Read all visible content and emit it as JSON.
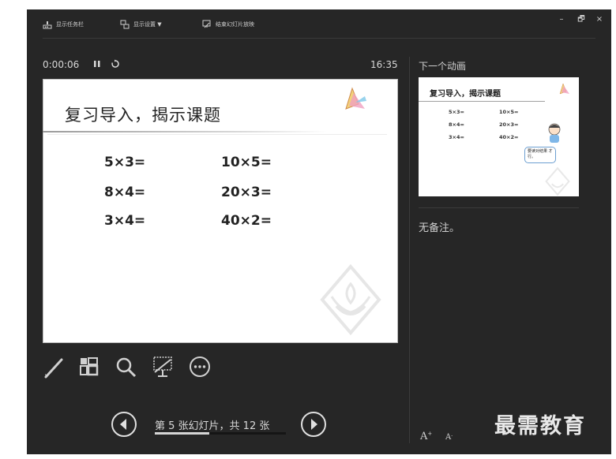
{
  "toolbar": {
    "show_taskbar": "显示任务栏",
    "display_settings": "显示设置 ▼",
    "end_show": "结束幻灯片放映"
  },
  "window_controls": {
    "minimize": "–",
    "restore": "🗗",
    "close": "×"
  },
  "timer": {
    "elapsed": "0:00:06",
    "pause_glyph": "⏸",
    "restart_glyph": "↻"
  },
  "clock": "16:35",
  "slide": {
    "title": "复习导入，揭示课题",
    "equations_left": [
      "5×3=",
      "8×4=",
      "3×4="
    ],
    "equations_right": [
      "10×5=",
      "20×3=",
      "40×2="
    ]
  },
  "tools": [
    {
      "name": "pen-tool-icon"
    },
    {
      "name": "slides-grid-icon"
    },
    {
      "name": "zoom-icon"
    },
    {
      "name": "laser-pointer-icon"
    },
    {
      "name": "more-options-icon"
    }
  ],
  "navigation": {
    "slide_count": "第 5 张幻灯片，共 12 张",
    "progress": 0.4167
  },
  "next_panel": {
    "label": "下一个动画",
    "thumb_title": "复习导入，揭示课题",
    "thumb_equations_left": [
      "5×3=",
      "8×4=",
      "3×4="
    ],
    "thumb_equations_right": [
      "10×5=",
      "20×3=",
      "40×2="
    ],
    "bubble_text": "要读对结果 才行。"
  },
  "notes": "无备注。",
  "font_controls": {
    "increase": "A",
    "decrease": "A"
  },
  "brand": "最需教育"
}
